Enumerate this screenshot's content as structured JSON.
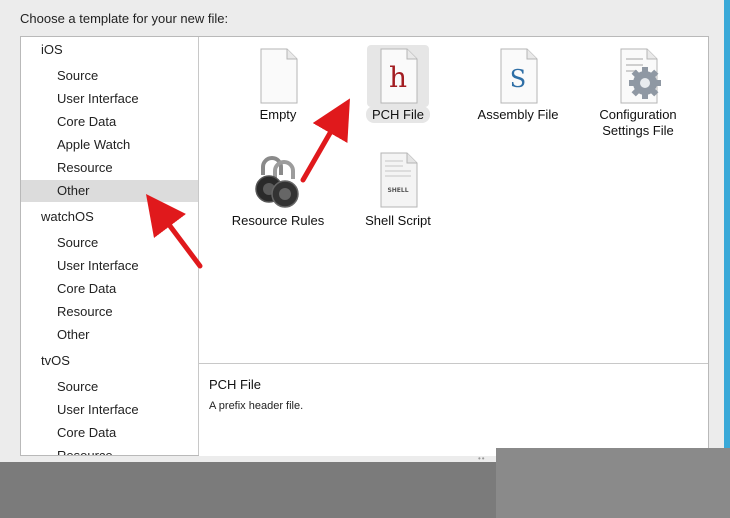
{
  "dialog": {
    "prompt": "Choose a template for your new file:"
  },
  "sidebar": {
    "rows": [
      {
        "label": "iOS",
        "kind": "group"
      },
      {
        "label": "Source",
        "kind": "item"
      },
      {
        "label": "User Interface",
        "kind": "item"
      },
      {
        "label": "Core Data",
        "kind": "item"
      },
      {
        "label": "Apple Watch",
        "kind": "item"
      },
      {
        "label": "Resource",
        "kind": "item"
      },
      {
        "label": "Other",
        "kind": "item",
        "selected": true
      },
      {
        "label": "watchOS",
        "kind": "group"
      },
      {
        "label": "Source",
        "kind": "item"
      },
      {
        "label": "User Interface",
        "kind": "item"
      },
      {
        "label": "Core Data",
        "kind": "item"
      },
      {
        "label": "Resource",
        "kind": "item"
      },
      {
        "label": "Other",
        "kind": "item"
      },
      {
        "label": "tvOS",
        "kind": "group"
      },
      {
        "label": "Source",
        "kind": "item"
      },
      {
        "label": "User Interface",
        "kind": "item"
      },
      {
        "label": "Core Data",
        "kind": "item"
      },
      {
        "label": "Resource",
        "kind": "item"
      }
    ]
  },
  "templates": [
    {
      "label": "Empty",
      "icon": "blank-document-icon"
    },
    {
      "label": "PCH File",
      "icon": "pch-header-icon",
      "glyph": "h",
      "selected": true
    },
    {
      "label": "Assembly File",
      "icon": "assembly-file-icon",
      "glyph": "S"
    },
    {
      "label": "Configuration Settings File",
      "icon": "gear-document-icon"
    },
    {
      "label": "Resource Rules",
      "icon": "padlock-icon"
    },
    {
      "label": "Shell Script",
      "icon": "shell-script-icon",
      "glyph": "SHELL"
    }
  ],
  "description": {
    "title": "PCH File",
    "text": "A prefix header file."
  },
  "annotations": {
    "arrow_color": "#e0191c"
  },
  "colors": {
    "window_edge": "#3aa9d8",
    "selection": "#dcdcdc"
  }
}
